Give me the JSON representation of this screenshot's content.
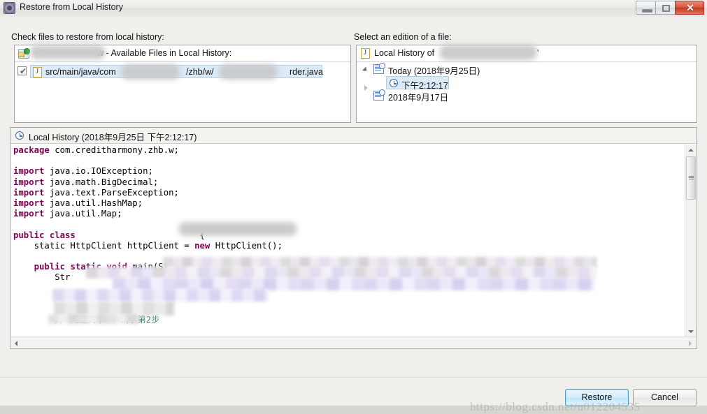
{
  "window": {
    "title": "Restore from Local History",
    "icon": "gear-icon",
    "minimize_label": "",
    "maximize_label": "",
    "close_label": "✕"
  },
  "left_panel": {
    "label": "Check files to restore from local history:",
    "header_icon": "project-folder-icon",
    "header_text_visible_suffix": "w - Available Files in Local History:",
    "header_redacted": true,
    "file_row": {
      "checked": true,
      "icon": "java-file-icon",
      "path_prefix": "src/main/java/com",
      "path_middle": "/zhb/w/",
      "path_suffix": "rder.java",
      "redacted_segments": 2,
      "selected": true
    }
  },
  "right_panel": {
    "label": "Select an edition of a file:",
    "header_icon": "java-file-icon",
    "header_text": "Local History of",
    "header_text_tail": "'",
    "header_redacted": true,
    "tree": [
      {
        "label": "Today (2018年9月25日)",
        "icon": "history-date-icon",
        "expanded": true,
        "twisty": "open",
        "children": [
          {
            "label": "下午2:12:17",
            "icon": "clock-icon",
            "selected": true
          }
        ]
      },
      {
        "label": "2018年9月17日",
        "icon": "history-date-icon",
        "expanded": false,
        "twisty": "closed",
        "children": []
      }
    ]
  },
  "code_panel": {
    "header_icon": "clock-icon",
    "header_text": "Local History (2018年9月25日 下午2:12:17)",
    "lines": [
      {
        "segments": [
          {
            "t": "package",
            "c": "kw"
          },
          {
            "t": " com.creditharmony.zhb.w;",
            "c": ""
          }
        ]
      },
      {
        "segments": [
          {
            "t": "",
            "c": ""
          }
        ]
      },
      {
        "segments": [
          {
            "t": "import",
            "c": "kw"
          },
          {
            "t": " java.io.IOException;",
            "c": ""
          }
        ]
      },
      {
        "segments": [
          {
            "t": "import",
            "c": "kw"
          },
          {
            "t": " java.math.BigDecimal;",
            "c": ""
          }
        ]
      },
      {
        "segments": [
          {
            "t": "import",
            "c": "kw"
          },
          {
            "t": " java.text.ParseException;",
            "c": ""
          }
        ]
      },
      {
        "segments": [
          {
            "t": "import",
            "c": "kw"
          },
          {
            "t": " java.util.HashMap;",
            "c": ""
          }
        ]
      },
      {
        "segments": [
          {
            "t": "import",
            "c": "kw"
          },
          {
            "t": " java.util.Map;",
            "c": ""
          }
        ]
      },
      {
        "segments": [
          {
            "t": "",
            "c": ""
          }
        ]
      },
      {
        "segments": [
          {
            "t": "public class",
            "c": "kw"
          },
          {
            "t": "                        {",
            "c": ""
          }
        ]
      },
      {
        "segments": [
          {
            "t": "    static HttpClient httpClient = ",
            "c": ""
          },
          {
            "t": "new",
            "c": "kw"
          },
          {
            "t": " HttpClient();",
            "c": ""
          }
        ]
      },
      {
        "segments": [
          {
            "t": "",
            "c": ""
          }
        ]
      },
      {
        "segments": [
          {
            "t": "    ",
            "c": ""
          },
          {
            "t": "public static void",
            "c": "kw"
          },
          {
            "t": " main(St",
            "c": ""
          }
        ]
      },
      {
        "segments": [
          {
            "t": "        Str",
            "c": ""
          }
        ]
      },
      {
        "segments": [
          {
            "t": "",
            "c": ""
          }
        ]
      },
      {
        "segments": [
          {
            "t": "",
            "c": ""
          }
        ]
      },
      {
        "segments": [
          {
            "t": "",
            "c": ""
          }
        ]
      },
      {
        "segments": [
          {
            "t": "        ",
            "c": ""
          },
          {
            "t": "// 问题列举 - 请求第2步",
            "c": "cm"
          }
        ]
      }
    ],
    "vertical_scrollbar": {
      "position": "near-top"
    },
    "horizontal_scrollbar": {
      "position": "left"
    }
  },
  "buttons": {
    "restore": "Restore",
    "cancel": "Cancel",
    "default": "restore"
  },
  "watermark": "https://blog.csdn.net/u012204535",
  "colors": {
    "keyword": "#7f0055",
    "comment": "#3f7f5f",
    "selection": "#dce9f7",
    "accent_button_border": "#4a9fc9",
    "close_button": "#c53a22",
    "dialog_bg": "#f0efec"
  }
}
